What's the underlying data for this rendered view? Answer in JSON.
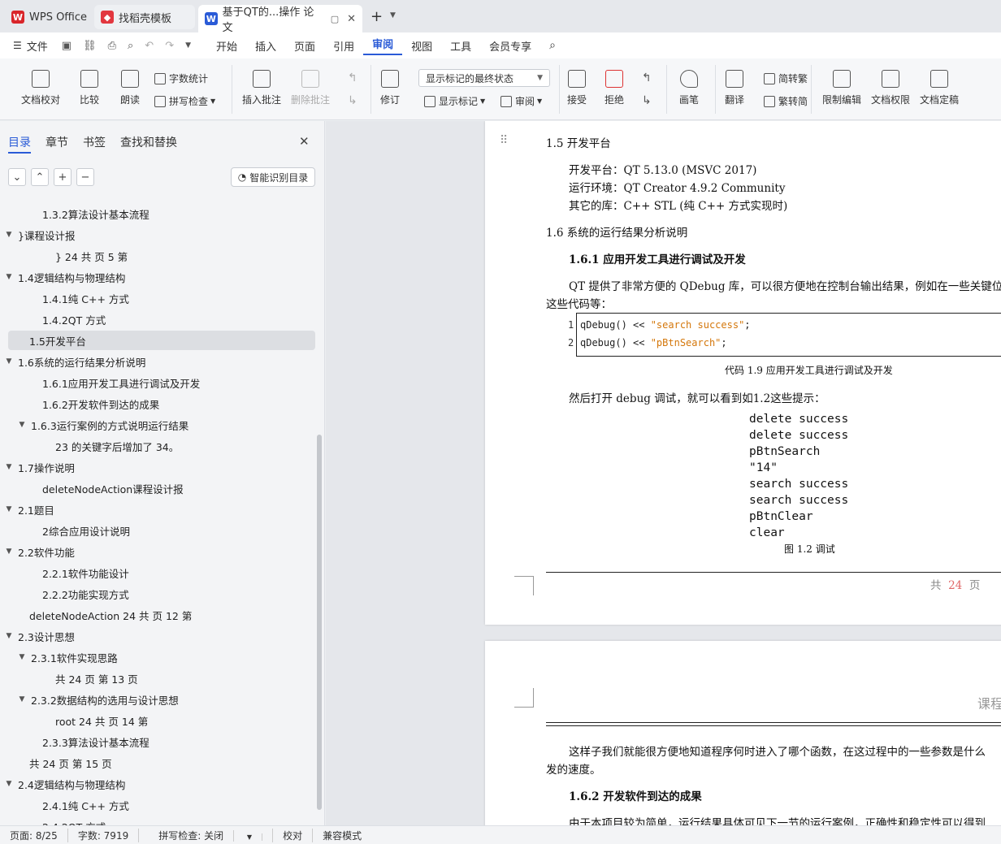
{
  "tabs": [
    {
      "label": "WPS Office"
    },
    {
      "label": "找稻壳模板"
    },
    {
      "label": "基于QT的...操作 论文"
    }
  ],
  "menu": {
    "file": "文件",
    "items": [
      "开始",
      "插入",
      "页面",
      "引用",
      "审阅",
      "视图",
      "工具",
      "会员专享"
    ],
    "active": "审阅"
  },
  "ribbon": {
    "proof": "文档校对",
    "compare": "比较",
    "read": "朗读",
    "wordcount": "字数统计",
    "spell": "拼写检查",
    "insert_comment": "插入批注",
    "delete_comment": "删除批注",
    "markup_state": "显示标记的最终状态",
    "revise": "修订",
    "show_markup": "显示标记",
    "review": "审阅",
    "accept": "接受",
    "reject": "拒绝",
    "pen": "画笔",
    "translate": "翻译",
    "trad": "简转繁",
    "simp": "繁转简",
    "restrict": "限制编辑",
    "rights": "文档权限",
    "finalize": "文档定稿"
  },
  "nav": {
    "tabs": [
      "目录",
      "章节",
      "书签",
      "查找和替换"
    ],
    "smart_label": "智能识别目录",
    "items": [
      {
        "label": "1.3.2算法设计基本流程",
        "arrow": ""
      },
      {
        "label": "}课程设计报",
        "arrow": "▼"
      },
      {
        "label": "} 24 共 页 5 第",
        "arrow": ""
      },
      {
        "label": "1.4逻辑结构与物理结构",
        "arrow": "▼"
      },
      {
        "label": "1.4.1纯 C++ 方式",
        "arrow": ""
      },
      {
        "label": "1.4.2QT 方式",
        "arrow": ""
      },
      {
        "label": "1.5开发平台",
        "arrow": ""
      },
      {
        "label": "1.6系统的运行结果分析说明",
        "arrow": "▼"
      },
      {
        "label": "1.6.1应用开发工具进行调试及开发",
        "arrow": ""
      },
      {
        "label": "1.6.2开发软件到达的成果",
        "arrow": ""
      },
      {
        "label": "1.6.3运行案例的方式说明运行结果",
        "arrow": "▼"
      },
      {
        "label": "23 的关键字后增加了 34。",
        "arrow": ""
      },
      {
        "label": "1.7操作说明",
        "arrow": "▼"
      },
      {
        "label": "deleteNodeAction课程设计报",
        "arrow": ""
      },
      {
        "label": "2.1题目",
        "arrow": "▼"
      },
      {
        "label": "2综合应用设计说明",
        "arrow": ""
      },
      {
        "label": "2.2软件功能",
        "arrow": "▼"
      },
      {
        "label": "2.2.1软件功能设计",
        "arrow": ""
      },
      {
        "label": "2.2.2功能实现方式",
        "arrow": ""
      },
      {
        "label": "deleteNodeAction  24  共 页 12 第",
        "arrow": ""
      },
      {
        "label": "2.3设计思想",
        "arrow": "▼"
      },
      {
        "label": "2.3.1软件实现思路",
        "arrow": "▼"
      },
      {
        "label": "共 24  页 第 13 页",
        "arrow": ""
      },
      {
        "label": "2.3.2数据结构的选用与设计思想",
        "arrow": "▼"
      },
      {
        "label": "root  24  共 页 14 第",
        "arrow": ""
      },
      {
        "label": "2.3.3算法设计基本流程",
        "arrow": ""
      },
      {
        "label": "共 24  页 第 15 页",
        "arrow": ""
      },
      {
        "label": "2.4逻辑结构与物理结构",
        "arrow": "▼"
      },
      {
        "label": "2.4.1纯 C++ 方式",
        "arrow": ""
      },
      {
        "label": "2.4.2QT 方式",
        "arrow": ""
      }
    ]
  },
  "doc": {
    "h15": "1.5 开发平台",
    "p1": "开发平台：QT 5.13.0 (MSVC 2017)",
    "p2": "运行环境：QT Creator 4.9.2 Community",
    "p3": "其它的库：C++ STL (纯 C++ 方式实现时)",
    "h16": "1.6 系统的运行结果分析说明",
    "h161": "1.6.1 应用开发工具进行调试及开发",
    "p4a": "QT 提供了非常方便的 QDebug 库，可以很方便地在控制台输出结果，例如在一些关键位",
    "p4b": "这些代码等：",
    "code1_num": "1",
    "code1_pre": "qDebug() << ",
    "code1_str": "\"search success\"",
    "code1_post": ";",
    "code2_num": "2",
    "code2_pre": "qDebug() << ",
    "code2_str": "\"pBtnSearch\"",
    "code2_post": ";",
    "code_caption": "代码 1.9 应用开发工具进行调试及开发",
    "p5": "然后打开 debug 调试，就可以看到如1.2这些提示：",
    "output": [
      "delete success",
      "delete success",
      "pBtnSearch",
      "\"14\"",
      "search success",
      "search success",
      "pBtnClear",
      "clear"
    ],
    "fig_caption": "图 1.2 调试",
    "footer_a": "共",
    "footer_num": "24",
    "footer_b": "页",
    "header2": "课程",
    "p6a": "这样子我们就能很方便地知道程序何时进入了哪个函数，在这过程中的一些参数是什么",
    "p6b": "发的速度。",
    "h162": "1.6.2 开发软件到达的成果",
    "p7": "由于本项目较为简单，运行结果具体可见下一节的运行案例，正确性和稳定性可以得到"
  },
  "status": {
    "page": "页面: 8/25",
    "words": "字数: 7919",
    "spell": "拼写检查: 关闭",
    "proof": "校对",
    "compat": "兼容模式"
  }
}
